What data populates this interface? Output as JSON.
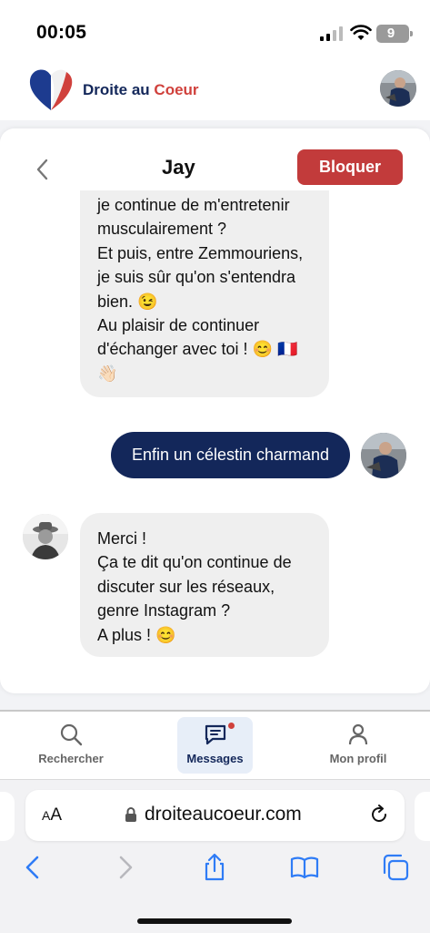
{
  "status_bar": {
    "time": "00:05",
    "battery": "9"
  },
  "header": {
    "brand_part1": "Droite au",
    "brand_part2": "Coeur"
  },
  "chat": {
    "contact_name": "Jay",
    "block_label": "Bloquer",
    "messages": [
      {
        "from": "Jay",
        "lines": [
          "je continue de m'entretenir",
          "musculairement ?",
          "Et puis, entre Zemmouriens,",
          "je suis sûr qu'on s'entendra",
          "bien. 😉",
          "Au plaisir de continuer",
          "d'échanger avec toi ! 😊 🇫🇷",
          "👋🏻"
        ]
      },
      {
        "from": "me",
        "lines": [
          "Enfin un célestin charmand"
        ]
      },
      {
        "from": "Jay",
        "lines": [
          "Merci !",
          "Ça te dit qu'on continue de",
          "discuter sur les réseaux,",
          "genre Instagram ?",
          "A plus ! 😊"
        ]
      }
    ]
  },
  "nav": {
    "search_label": "Rechercher",
    "messages_label": "Messages",
    "profile_label": "Mon profil"
  },
  "browser": {
    "url": "droiteaucoeur.com",
    "aa_small": "A",
    "aa_large": "A"
  },
  "colors": {
    "navy": "#13275a",
    "red": "#c23b3b",
    "bubble": "#efefef"
  }
}
